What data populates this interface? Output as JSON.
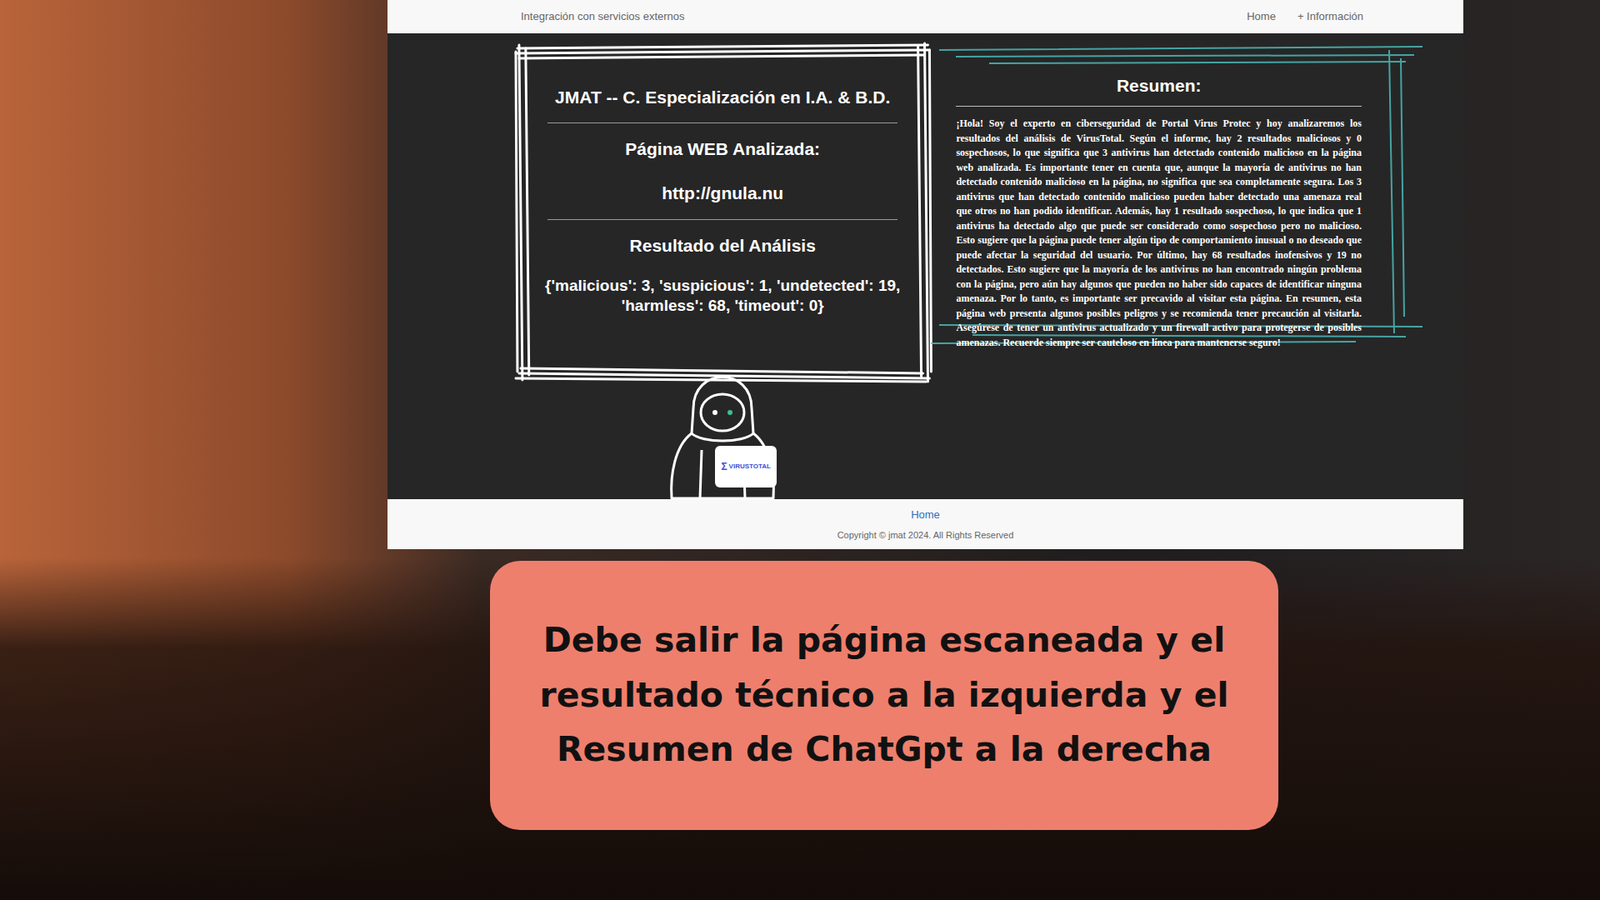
{
  "nav": {
    "brand": "Integración con servicios externos",
    "links": [
      {
        "label": "Home"
      },
      {
        "label": "+ Información"
      }
    ]
  },
  "report": {
    "title": "JMAT -- C. Especialización en I.A. & B.D.",
    "url_label": "Página WEB Analizada:",
    "url": "http://gnula.nu",
    "result_label": "Resultado del Análisis",
    "result": "{'malicious': 3, 'suspicious': 1, 'undetected': 19, 'harmless': 68, 'timeout': 0}"
  },
  "badge": {
    "icon": "Σ",
    "text": "VIRUSTOTAL"
  },
  "summary": {
    "title": "Resumen:",
    "text": "¡Hola! Soy el experto en ciberseguridad de Portal Virus Protec y hoy analizaremos los resultados del análisis de VirusTotal. Según el informe, hay 2 resultados maliciosos y 0 sospechosos, lo que significa que 3 antivirus han detectado contenido malicioso en la página web analizada. Es importante tener en cuenta que, aunque la mayoría de antivirus no han detectado contenido malicioso en la página, no significa que sea completamente segura. Los 3 antivirus que han detectado contenido malicioso pueden haber detectado una amenaza real que otros no han podido identificar. Además, hay 1 resultado sospechoso, lo que indica que 1 antivirus ha detectado algo que puede ser considerado como sospechoso pero no malicioso. Esto sugiere que la página puede tener algún tipo de comportamiento inusual o no deseado que puede afectar la seguridad del usuario. Por último, hay 68 resultados inofensivos y 19 no detectados. Esto sugiere que la mayoría de los antivirus no han encontrado ningún problema con la página, pero aún hay algunos que pueden no haber sido capaces de identificar ninguna amenaza. Por lo tanto, es importante ser precavido al visitar esta página. En resumen, esta página web presenta algunos posibles peligros y se recomienda tener precaución al visitarla. Asegúrese de tener un antivirus actualizado y un firewall activo para protegerse de posibles amenazas. Recuerde siempre ser cauteloso en línea para mantenerse seguro!"
  },
  "footer": {
    "link": "Home",
    "copyright": "Copyright © jmat 2024. All Rights Reserved"
  },
  "caption": "Debe salir la página escaneada y el resultado técnico a la izquierda y el Resumen de ChatGpt a la derecha"
}
